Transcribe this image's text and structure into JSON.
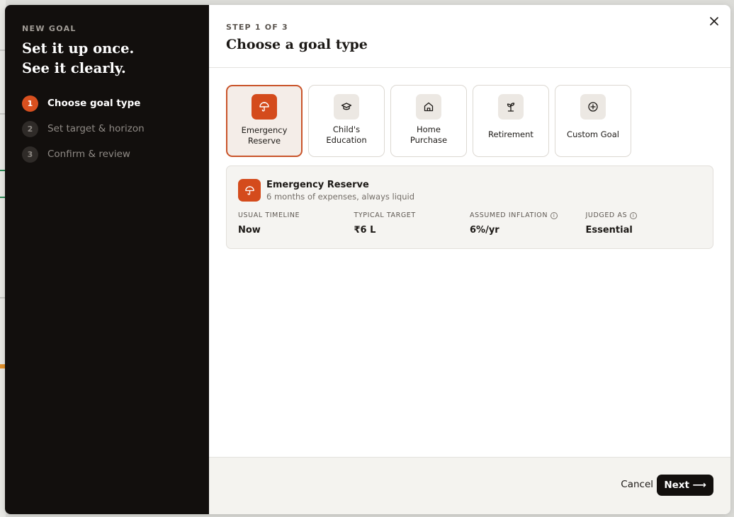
{
  "sidebar": {
    "eyebrow": "NEW GOAL",
    "headline_line1": "Set it up once.",
    "headline_line2": "See it clearly.",
    "steps": [
      {
        "num": "1",
        "label": "Choose goal type",
        "active": true
      },
      {
        "num": "2",
        "label": "Set target & horizon",
        "active": false
      },
      {
        "num": "3",
        "label": "Confirm & review",
        "active": false
      }
    ]
  },
  "header": {
    "step_text": "STEP 1 OF 3",
    "title": "Choose a goal type",
    "close_icon": "close-icon"
  },
  "goal_types": [
    {
      "label": "Emergency\nReserve",
      "icon": "umbrella-icon",
      "selected": true
    },
    {
      "label": "Child's\nEducation",
      "icon": "graduation-cap-icon",
      "selected": false
    },
    {
      "label": "Home\nPurchase",
      "icon": "home-icon",
      "selected": false
    },
    {
      "label": "Retirement",
      "icon": "sprout-icon",
      "selected": false
    },
    {
      "label": "Custom Goal",
      "icon": "plus-circle-icon",
      "selected": false
    }
  ],
  "detail": {
    "name": "Emergency Reserve",
    "description": "6 months of expenses, always liquid",
    "stats": [
      {
        "label": "USUAL TIMELINE",
        "value": "Now",
        "info": false
      },
      {
        "label": "TYPICAL TARGET",
        "value": "₹6 L",
        "info": false
      },
      {
        "label": "ASSUMED INFLATION",
        "value": "6%/yr",
        "info": true
      },
      {
        "label": "JUDGED AS",
        "value": "Essential",
        "info": true
      }
    ]
  },
  "footer": {
    "cancel_label": "Cancel",
    "next_label": "Next ⟶"
  },
  "colors": {
    "accent": "#d44b1c",
    "sidebar_bg": "#120f0d"
  }
}
